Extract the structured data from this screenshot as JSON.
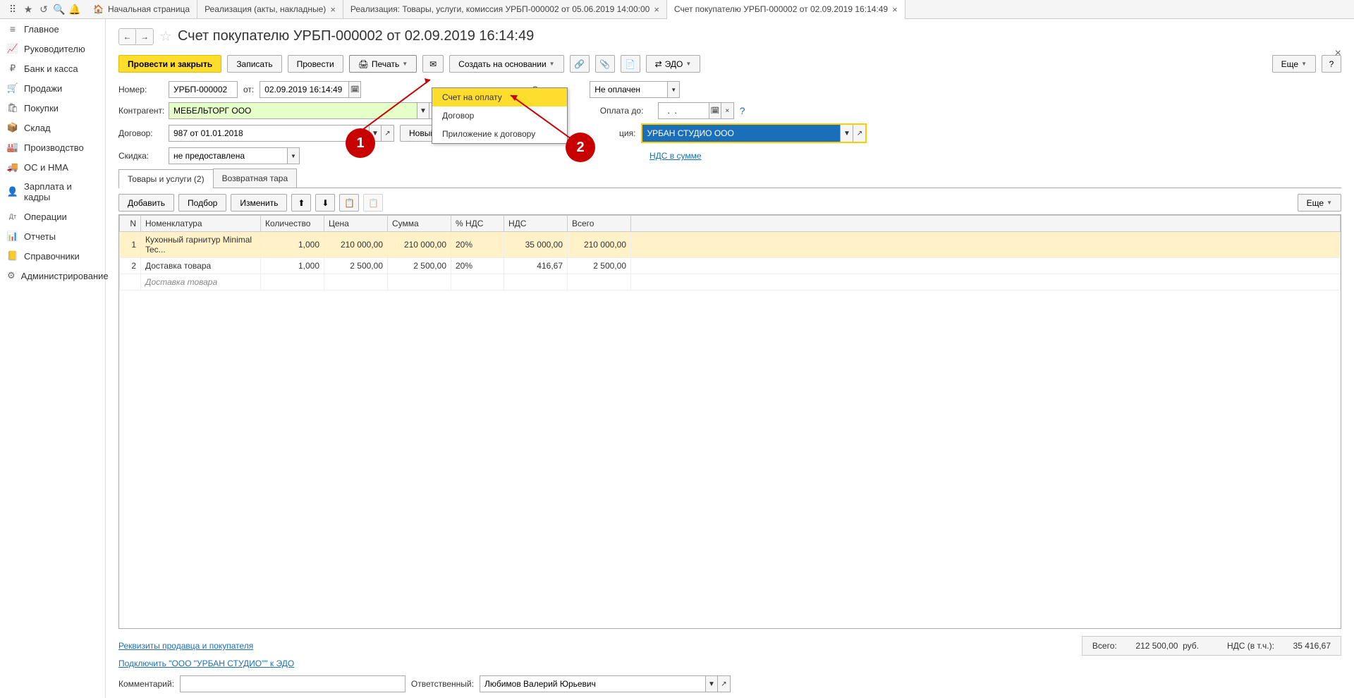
{
  "top_tabs": {
    "home": "Начальная страница",
    "t1": "Реализация (акты, накладные)",
    "t2": "Реализация: Товары, услуги, комиссия УРБП-000002 от 05.06.2019 14:00:00",
    "t3": "Счет покупателю УРБП-000002 от 02.09.2019 16:14:49"
  },
  "sidebar": {
    "items": [
      {
        "icon": "≡",
        "label": "Главное"
      },
      {
        "icon": "📈",
        "label": "Руководителю"
      },
      {
        "icon": "₽",
        "label": "Банк и касса"
      },
      {
        "icon": "🛒",
        "label": "Продажи"
      },
      {
        "icon": "🛍",
        "label": "Покупки"
      },
      {
        "icon": "📦",
        "label": "Склад"
      },
      {
        "icon": "🏭",
        "label": "Производство"
      },
      {
        "icon": "🚚",
        "label": "ОС и НМА"
      },
      {
        "icon": "👤",
        "label": "Зарплата и кадры"
      },
      {
        "icon": "Дт",
        "label": "Операции"
      },
      {
        "icon": "📊",
        "label": "Отчеты"
      },
      {
        "icon": "📒",
        "label": "Справочники"
      },
      {
        "icon": "⚙",
        "label": "Администрирование"
      }
    ]
  },
  "page": {
    "title": "Счет покупателю УРБП-000002 от 02.09.2019 16:14:49"
  },
  "toolbar": {
    "post_close": "Провести и закрыть",
    "save": "Записать",
    "post": "Провести",
    "print": "Печать",
    "create_based": "Создать на основании",
    "edo": "ЭДО",
    "more": "Еще"
  },
  "print_menu": {
    "i1": "Счет на оплату",
    "i2": "Договор",
    "i3": "Приложение к договору"
  },
  "form": {
    "number_label": "Номер:",
    "number": "УРБП-000002",
    "from": "от:",
    "date": "02.09.2019 16:14:49",
    "counterparty_label": "Контрагент:",
    "counterparty": "МЕБЕЛЬТОРГ ООО",
    "contract_label": "Договор:",
    "contract": "987 от 01.01.2018",
    "new_btn": "Новый",
    "discount_label": "Скидка:",
    "discount": "не предоставлена",
    "status_label": "Статус:",
    "status": "Не оплачен",
    "pay_until_label": "Оплата до:",
    "pay_until": "  .  .",
    "org_label_suffix": "ция:",
    "org": "УРБАН СТУДИО ООО",
    "vat_link": "НДС в сумме"
  },
  "tabs": {
    "goods": "Товары и услуги (2)",
    "tare": "Возвратная тара"
  },
  "table_toolbar": {
    "add": "Добавить",
    "pick": "Подбор",
    "change": "Изменить",
    "more": "Еще"
  },
  "table": {
    "headers": {
      "n": "N",
      "item": "Номенклатура",
      "qty": "Количество",
      "price": "Цена",
      "sum": "Сумма",
      "vat_rate": "% НДС",
      "vat": "НДС",
      "total": "Всего"
    },
    "rows": [
      {
        "n": "1",
        "item": "Кухонный гарнитур Minimal Tec...",
        "qty": "1,000",
        "price": "210 000,00",
        "sum": "210 000,00",
        "vat_rate": "20%",
        "vat": "35 000,00",
        "total": "210 000,00"
      },
      {
        "n": "2",
        "item": "Доставка товара",
        "qty": "1,000",
        "price": "2 500,00",
        "sum": "2 500,00",
        "vat_rate": "20%",
        "vat": "416,67",
        "total": "2 500,00"
      }
    ],
    "sub_row": "Доставка товара"
  },
  "footer": {
    "details_link": "Реквизиты продавца и покупателя",
    "edo_link": "Подключить \"ООО \"УРБАН СТУДИО\"\" к ЭДО",
    "total_label": "Всего:",
    "total": "212 500,00",
    "rub": "руб.",
    "vat_label": "НДС (в т.ч.):",
    "vat": "35 416,67",
    "comment_label": "Комментарий:",
    "responsible_label": "Ответственный:",
    "responsible": "Любимов Валерий Юрьевич"
  },
  "annotations": {
    "a1": "1",
    "a2": "2"
  }
}
